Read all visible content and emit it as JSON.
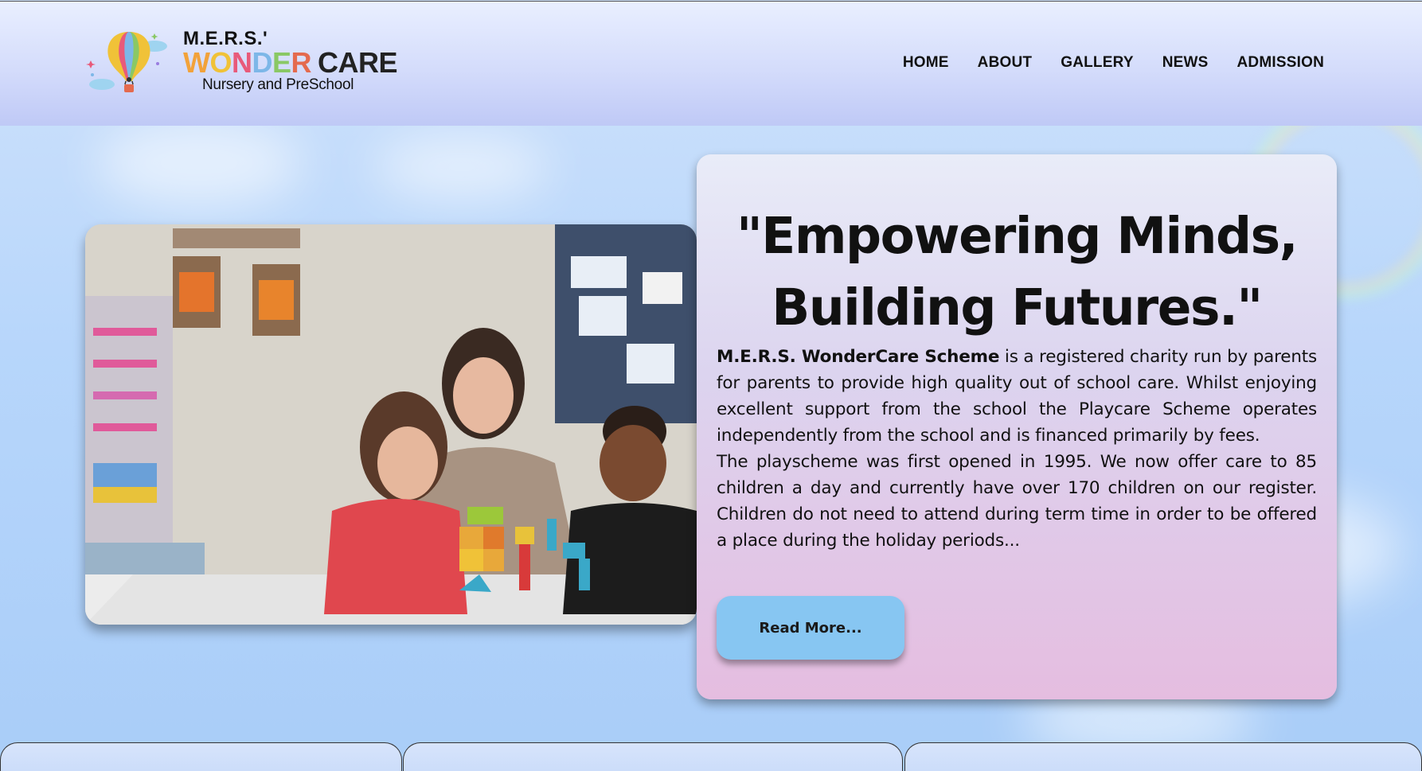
{
  "header": {
    "logo": {
      "line1": "M.E.R.S.'",
      "wonder_letters": [
        "W",
        "O",
        "N",
        "D",
        "E",
        "R"
      ],
      "care": "CARE",
      "subtitle": "Nursery and PreSchool"
    },
    "nav": [
      {
        "label": "HOME"
      },
      {
        "label": "ABOUT"
      },
      {
        "label": "GALLERY"
      },
      {
        "label": "NEWS"
      },
      {
        "label": "ADMISSION"
      }
    ]
  },
  "hero": {
    "image_alt": "Teacher with two children playing with colorful building blocks in a classroom",
    "heading": "\"Empowering Minds, Building Futures.\"",
    "intro_bold": "M.E.R.S. WonderCare Scheme",
    "intro_rest": " is a registered charity run by parents for parents to provide high quality out of school care. Whilst enjoying excellent support from the school the Playcare Scheme operates independently from the school and is financed primarily by fees.",
    "paragraph2": "The playscheme was first opened in 1995. We now offer care to 85 children a day and currently have over 170 children on our register. Children do not need to attend during term time in order to be offered a place during the holiday periods...",
    "button_label": "Read More..."
  },
  "colors": {
    "button": "#87c6f2",
    "header_gradient_top": "#e9efff",
    "header_gradient_bottom": "#bfc9f6",
    "card_gradient_top": "#e9ecf8",
    "card_gradient_bottom": "#e5bde0"
  }
}
